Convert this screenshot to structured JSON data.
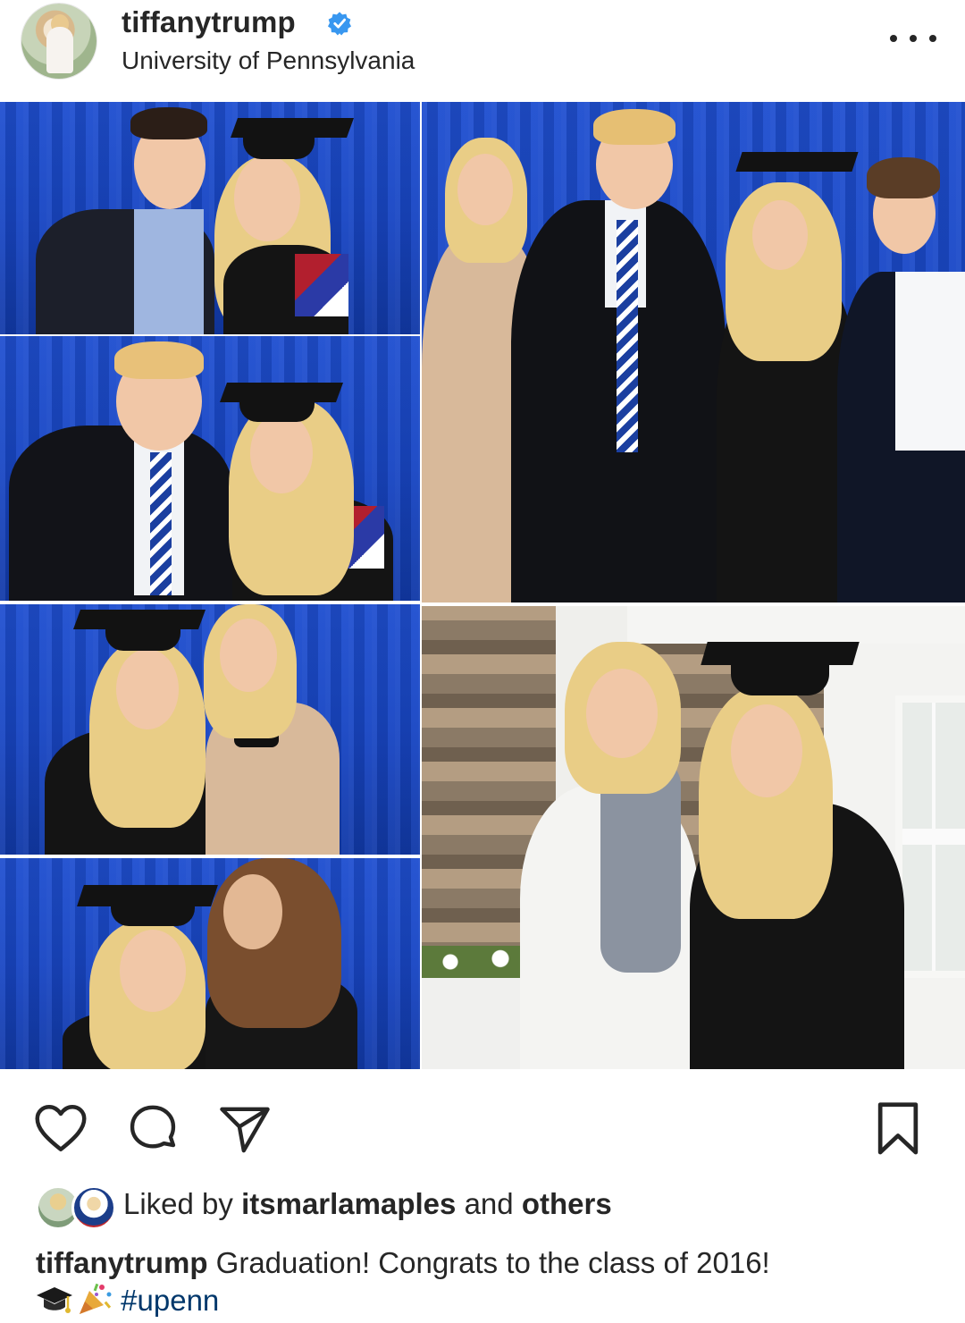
{
  "post": {
    "username": "tiffanytrump",
    "location": "University of Pennsylvania"
  },
  "icons": {
    "verified": "verified-badge-icon",
    "more": "more-options-icon",
    "like": "heart-icon",
    "comment": "comment-icon",
    "share": "send-icon",
    "save": "bookmark-icon",
    "emoji_1": "graduation-cap-emoji",
    "emoji_2": "party-popper-emoji"
  },
  "colors": {
    "verified_blue": "#3897f0",
    "hashtag": "#00376b",
    "text": "#262626"
  },
  "likes": {
    "prefix": "Liked by",
    "user": "itsmarlamaples",
    "middle": "and",
    "others": "others"
  },
  "caption": {
    "username": "tiffanytrump",
    "text": "Graduation! Congrats to the class of 2016!",
    "hashtag": "#upenn"
  }
}
